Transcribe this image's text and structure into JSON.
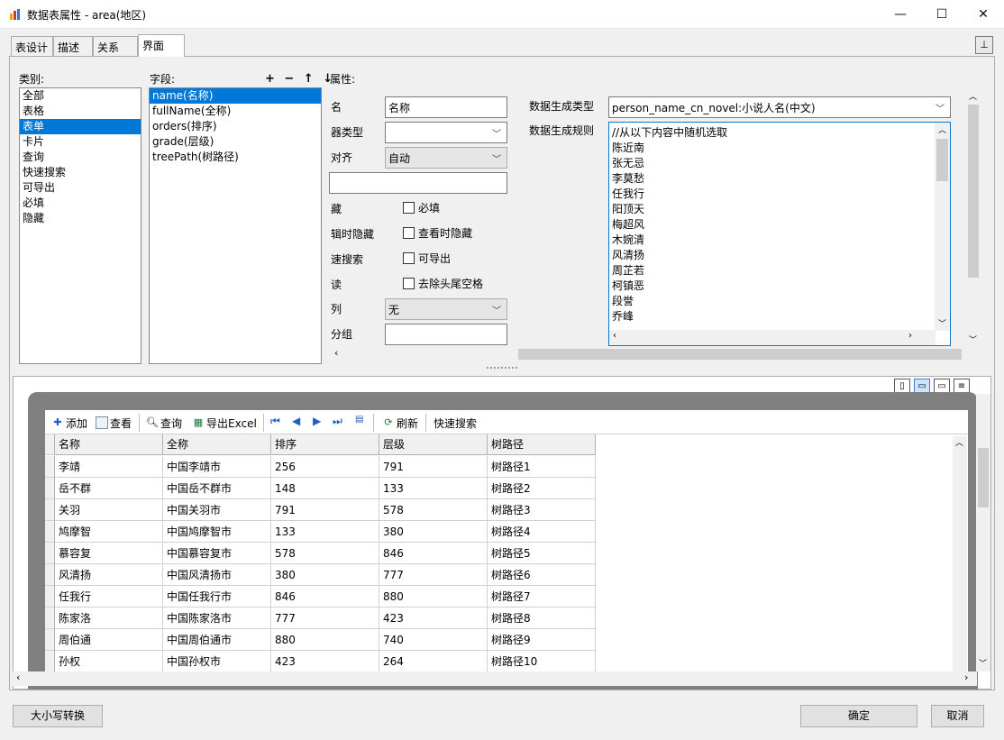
{
  "window": {
    "title": "数据表属性 - area(地区)",
    "minimize": "—",
    "maximize": "☐",
    "close": "✕"
  },
  "tabs": [
    {
      "label": "表设计"
    },
    {
      "label": "描述"
    },
    {
      "label": "关系"
    },
    {
      "label": "界面"
    }
  ],
  "pin_label": "⊥",
  "category": {
    "label": "类别:",
    "items": [
      "全部",
      "表格",
      "表单",
      "卡片",
      "查询",
      "快速搜索",
      "可导出",
      "必填",
      "隐藏"
    ],
    "selected": "表单"
  },
  "fields": {
    "label": "字段:",
    "ops": "+ − ↑ ↓",
    "items": [
      "name(名称)",
      "fullName(全称)",
      "orders(排序)",
      "grade(层级)",
      "treePath(树路径)"
    ],
    "selected": "name(名称)"
  },
  "props": {
    "label": "属性:",
    "name_label": "名",
    "name_value": "名称",
    "editor_type_label": "器类型",
    "editor_type_value": "",
    "align_label": "对齐",
    "align_value": "自动",
    "blank_value": "",
    "hidden_label": "藏",
    "required_label": "必填",
    "edit_hidden_label": "辑时隐藏",
    "view_hidden_label": "查看时隐藏",
    "quick_search_label": "速搜索",
    "exportable_label": "可导出",
    "readonly_label": "读",
    "trim_label": "去除头尾空格",
    "column_label": "列",
    "column_value": "无",
    "group_label": "分组",
    "group_value": "",
    "gen_type_label": "数据生成类型",
    "gen_type_value": "person_name_cn_novel:小说人名(中文)",
    "gen_rule_label": "数据生成规则",
    "gen_rule_lines": [
      "//从以下内容中随机选取",
      "陈近南",
      "张无忌",
      "李莫愁",
      "任我行",
      "阳顶天",
      "梅超风",
      "木婉清",
      "风清扬",
      "周芷若",
      "柯镇恶",
      "段誉",
      "乔峰"
    ]
  },
  "toolbar": {
    "add": "添加",
    "view": "查看",
    "query": "查询",
    "export": "导出Excel",
    "refresh": "刷新",
    "quick_search": "快速搜索"
  },
  "grid": {
    "columns": [
      "名称",
      "全称",
      "排序",
      "层级",
      "树路径"
    ],
    "rows": [
      [
        "李靖",
        "中国李靖市",
        "256",
        "791",
        "树路径1"
      ],
      [
        "岳不群",
        "中国岳不群市",
        "148",
        "133",
        "树路径2"
      ],
      [
        "关羽",
        "中国关羽市",
        "791",
        "578",
        "树路径3"
      ],
      [
        "鸠摩智",
        "中国鸠摩智市",
        "133",
        "380",
        "树路径4"
      ],
      [
        "慕容复",
        "中国慕容复市",
        "578",
        "846",
        "树路径5"
      ],
      [
        "风清扬",
        "中国风清扬市",
        "380",
        "777",
        "树路径6"
      ],
      [
        "任我行",
        "中国任我行市",
        "846",
        "880",
        "树路径7"
      ],
      [
        "陈家洛",
        "中国陈家洛市",
        "777",
        "423",
        "树路径8"
      ],
      [
        "周伯通",
        "中国周伯通市",
        "880",
        "740",
        "树路径9"
      ],
      [
        "孙权",
        "中国孙权市",
        "423",
        "264",
        "树路径10"
      ]
    ]
  },
  "buttons": {
    "case_convert": "大小写转换",
    "ok": "确定",
    "cancel": "取消"
  },
  "colors": {
    "selection": "#0078d7",
    "frame_gray": "#808080"
  }
}
